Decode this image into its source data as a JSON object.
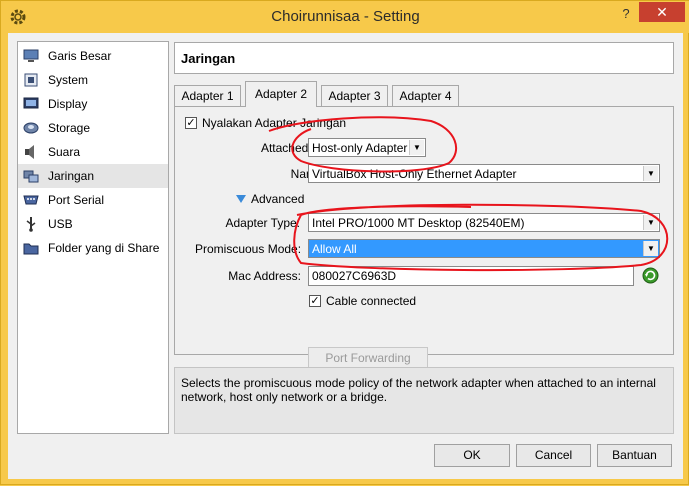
{
  "window": {
    "title": "Choirunnisaa - Setting",
    "help_label": "?",
    "close_label": "✕"
  },
  "sidebar": {
    "items": [
      {
        "label": "Garis Besar",
        "icon": "monitor-icon"
      },
      {
        "label": "System",
        "icon": "chip-icon"
      },
      {
        "label": "Display",
        "icon": "display-icon"
      },
      {
        "label": "Storage",
        "icon": "disk-icon"
      },
      {
        "label": "Suara",
        "icon": "speaker-icon"
      },
      {
        "label": "Jaringan",
        "icon": "network-icon"
      },
      {
        "label": "Port Serial",
        "icon": "serial-port-icon"
      },
      {
        "label": "USB",
        "icon": "usb-icon"
      },
      {
        "label": "Folder yang di Share",
        "icon": "folder-icon"
      }
    ],
    "selected": "Jaringan"
  },
  "header": {
    "title": "Jaringan"
  },
  "tabs": [
    {
      "label": "Adapter 1"
    },
    {
      "label": "Adapter 2"
    },
    {
      "label": "Adapter 3"
    },
    {
      "label": "Adapter 4"
    }
  ],
  "active_tab": "Adapter 2",
  "adapter": {
    "enable_label": "Nyalakan Adapter Jaringan",
    "enable_checked": true,
    "attached_label": "Attached to:",
    "attached_value": "Host-only Adapter",
    "name_label": "Name:",
    "name_value": "VirtualBox Host-Only Ethernet Adapter",
    "advanced_label": "Advanced",
    "adapter_type_label": "Adapter Type:",
    "adapter_type_value": "Intel PRO/1000 MT Desktop (82540EM)",
    "promisc_label": "Promiscuous Mode:",
    "promisc_value": "Allow All",
    "mac_label": "Mac Address:",
    "mac_value": "080027C6963D",
    "cable_label": "Cable connected",
    "cable_checked": true,
    "port_forwarding_label": "Port Forwarding"
  },
  "description": "Selects the promiscuous mode policy of the network adapter when attached to an internal network, host only network or a bridge.",
  "footer": {
    "ok_label": "OK",
    "cancel_label": "Cancel",
    "help_label": "Bantuan"
  },
  "colors": {
    "title_bar": "#f7c94a",
    "close": "#c7402f",
    "selection": "#3399ff",
    "annotation": "#e8141c"
  }
}
